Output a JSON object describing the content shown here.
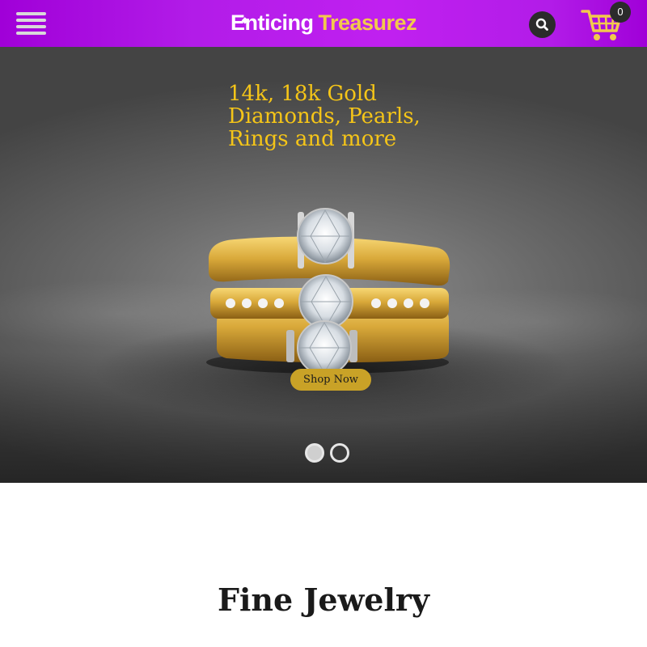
{
  "header": {
    "logo_word1": "Enticing",
    "logo_word2": "Treasurez",
    "cart_count": "0",
    "icons": [
      "hamburger-menu-icon",
      "search-icon",
      "shopping-cart-icon"
    ],
    "colors": {
      "header_bg": "#b21ce8",
      "logo_accent": "#f2c94c",
      "cart": "#f2c94c"
    }
  },
  "hero": {
    "headline_lines": [
      "14k, 18k Gold",
      "Diamonds, Pearls,",
      "Rings and more"
    ],
    "cta_label": "Shop Now",
    "slides_total": 2,
    "slide_active": 1,
    "colors": {
      "headline": "#f5c518",
      "cta_bg": "#c9a227"
    }
  },
  "content": {
    "section_title": "Fine Jewelry"
  }
}
